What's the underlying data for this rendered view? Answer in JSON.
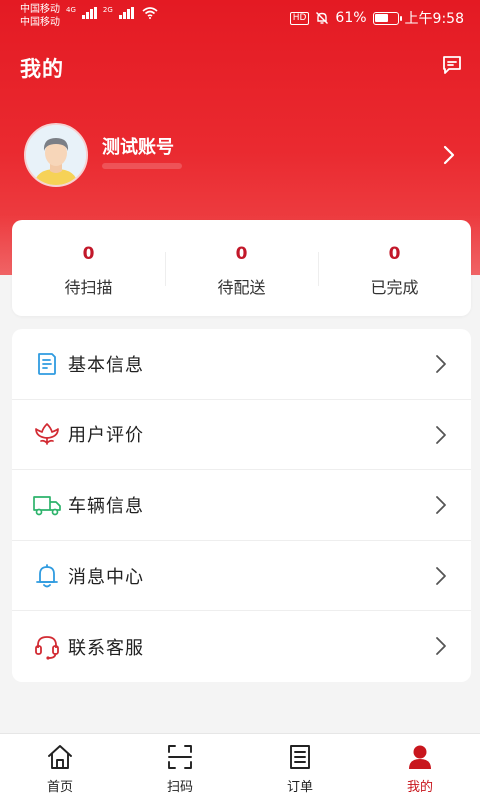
{
  "status_bar": {
    "carrier_1": "中国移动",
    "carrier_2": "中国移动",
    "net_1": "4G",
    "net_2": "2G",
    "hd": "HD",
    "battery_percent": "61%",
    "battery_level": 0.61,
    "time": "上午9:58"
  },
  "header": {
    "title": "我的",
    "message_icon": "message-icon"
  },
  "profile": {
    "name": "测试账号",
    "avatar_icon": "avatar-icon"
  },
  "stats": [
    {
      "value": "0",
      "label": "待扫描"
    },
    {
      "value": "0",
      "label": "待配送"
    },
    {
      "value": "0",
      "label": "已完成"
    }
  ],
  "menu": [
    {
      "label": "基本信息",
      "icon": "document-icon"
    },
    {
      "label": "用户评价",
      "icon": "flower-icon"
    },
    {
      "label": "车辆信息",
      "icon": "truck-icon"
    },
    {
      "label": "消息中心",
      "icon": "bell-icon"
    },
    {
      "label": "联系客服",
      "icon": "headset-icon"
    }
  ],
  "nav": [
    {
      "label": "首页",
      "icon": "home-icon"
    },
    {
      "label": "扫码",
      "icon": "scan-icon"
    },
    {
      "label": "订单",
      "icon": "order-list-icon"
    },
    {
      "label": "我的",
      "icon": "user-icon",
      "active": true
    }
  ],
  "colors": {
    "brand_red": "#e41a23",
    "stat_value": "#c2182a",
    "nav_active": "#c8161d"
  }
}
